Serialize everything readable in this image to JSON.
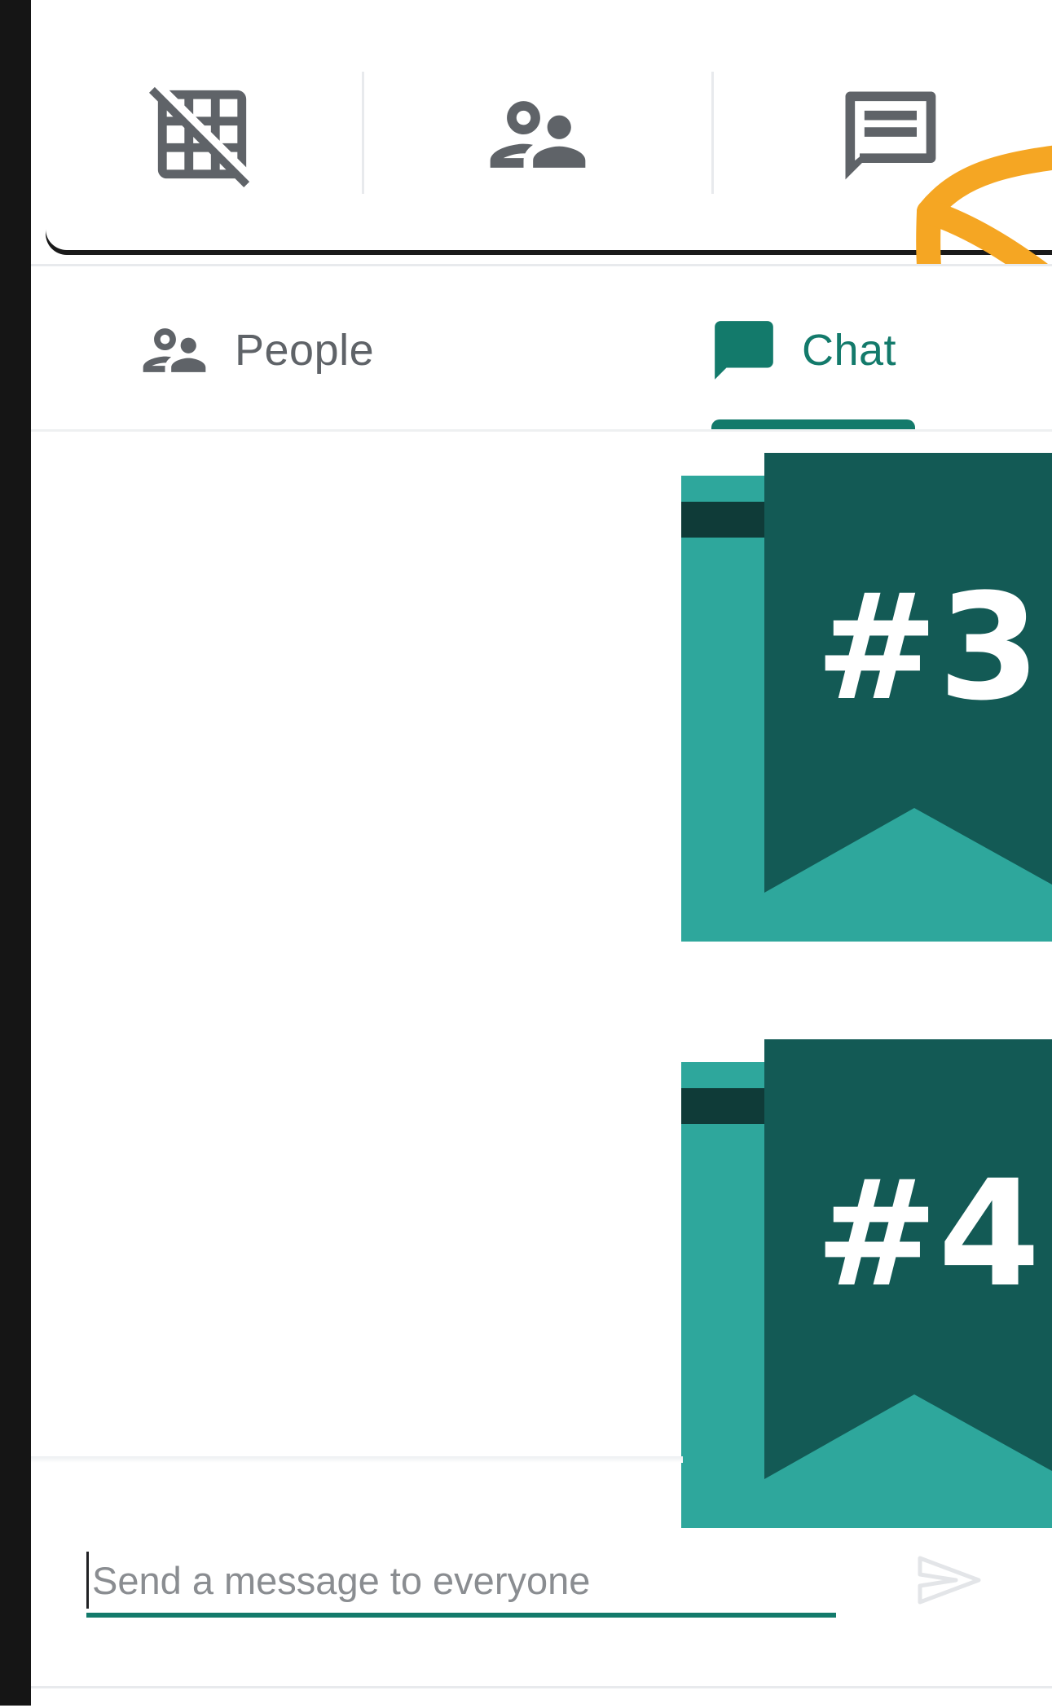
{
  "toolbar": {
    "buttons": [
      {
        "icon": "grid-off-icon"
      },
      {
        "icon": "people-icon"
      },
      {
        "icon": "chat-icon"
      }
    ]
  },
  "tabs": [
    {
      "label": "People",
      "icon": "people-icon",
      "selected": false
    },
    {
      "label": "Chat",
      "icon": "chat-icon",
      "selected": true
    }
  ],
  "badges": [
    {
      "label": "#3"
    },
    {
      "label": "#4"
    }
  ],
  "composer": {
    "placeholder": "Send a message to everyone",
    "value": "",
    "send_icon": "send-icon"
  },
  "colors": {
    "accent": "#137a6b",
    "icon_gray": "#5f6368",
    "badge_dark": "#135a55",
    "badge_light": "#2ea79c",
    "annotation": "#f5a623"
  }
}
